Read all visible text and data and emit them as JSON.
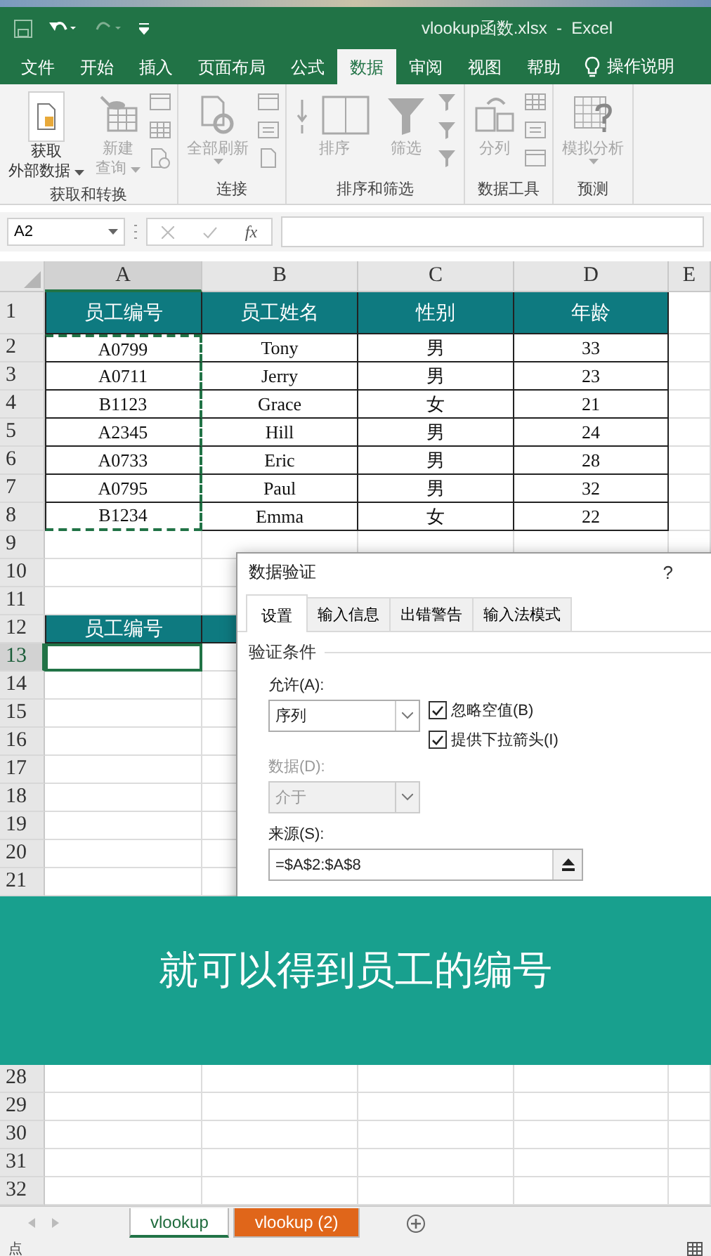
{
  "window": {
    "title": "vlookup函数.xlsx  -  Excel"
  },
  "ribbon_tabs": [
    {
      "label": "文件",
      "selected": false,
      "kind": "tab"
    },
    {
      "label": "开始",
      "selected": false,
      "kind": "tab"
    },
    {
      "label": "插入",
      "selected": false,
      "kind": "tab"
    },
    {
      "label": "页面布局",
      "selected": false,
      "kind": "tab"
    },
    {
      "label": "公式",
      "selected": false,
      "kind": "tab"
    },
    {
      "label": "数据",
      "selected": true,
      "kind": "tab"
    },
    {
      "label": "审阅",
      "selected": false,
      "kind": "tab"
    },
    {
      "label": "视图",
      "selected": false,
      "kind": "tab"
    },
    {
      "label": "帮助",
      "selected": false,
      "kind": "tab"
    },
    {
      "label": "操作说明",
      "selected": false,
      "kind": "tell_me"
    }
  ],
  "ribbon": {
    "groups": [
      {
        "label": "获取和转换",
        "buttons": [
          {
            "lines": [
              "获取",
              "外部数据"
            ],
            "kind": "get_data",
            "dropdown": true,
            "disabled": false
          },
          {
            "lines": [
              "新建",
              "查询"
            ],
            "kind": "new_query",
            "dropdown": true,
            "disabled": true
          }
        ],
        "small_tools": [
          {
            "kind": "table"
          },
          {
            "kind": "grid"
          },
          {
            "kind": "clock"
          }
        ]
      },
      {
        "label": "连接",
        "buttons": [
          {
            "lines": [
              "全部刷新"
            ],
            "kind": "refresh",
            "dropdown": true,
            "disabled": true
          }
        ],
        "small_tools": [
          {
            "kind": "table"
          },
          {
            "kind": "list"
          },
          {
            "kind": "doc"
          }
        ]
      },
      {
        "label": "排序和筛选",
        "buttons": [
          {
            "lines": [
              "排序"
            ],
            "kind": "sort",
            "dropdown": false,
            "disabled": true
          },
          {
            "lines": [
              "筛选"
            ],
            "kind": "filter",
            "dropdown": false,
            "disabled": true
          }
        ],
        "small_tools": [
          {
            "kind": "funnel"
          },
          {
            "kind": "funnel"
          },
          {
            "kind": "funnel"
          }
        ]
      },
      {
        "label": "数据工具",
        "buttons": [
          {
            "lines": [
              "分列"
            ],
            "kind": "split",
            "dropdown": false,
            "disabled": true
          }
        ],
        "small_tools": [
          {
            "kind": "grid"
          },
          {
            "kind": "list"
          },
          {
            "kind": "table"
          }
        ]
      },
      {
        "label": "预测",
        "buttons": [
          {
            "lines": [
              "模拟分析"
            ],
            "kind": "what_if",
            "dropdown": true,
            "disabled": true
          }
        ]
      }
    ]
  },
  "formula_bar": {
    "name_box": "A2",
    "function_label": "fx"
  },
  "columns": [
    {
      "label": "A",
      "selected": true
    },
    {
      "label": "B",
      "selected": false
    },
    {
      "label": "C",
      "selected": false
    },
    {
      "label": "D",
      "selected": false
    },
    {
      "label": "E",
      "selected": false
    }
  ],
  "rows": [
    {
      "label": "1",
      "selected": false,
      "cells": [
        {
          "kind": "table_header",
          "text": "员工编号"
        },
        {
          "kind": "table_header",
          "text": "员工姓名"
        },
        {
          "kind": "table_header",
          "text": "性别"
        },
        {
          "kind": "table_header",
          "text": "年龄"
        }
      ]
    },
    {
      "label": "2",
      "selected": false,
      "cells": [
        {
          "kind": "table_cell",
          "text": "A0799",
          "copied": true
        },
        {
          "kind": "table_cell",
          "text": "Tony"
        },
        {
          "kind": "table_cell",
          "text": "男"
        },
        {
          "kind": "table_cell",
          "text": "33"
        }
      ]
    },
    {
      "label": "3",
      "selected": false,
      "cells": [
        {
          "kind": "table_cell",
          "text": "A0711",
          "copied": true
        },
        {
          "kind": "table_cell",
          "text": "Jerry"
        },
        {
          "kind": "table_cell",
          "text": "男"
        },
        {
          "kind": "table_cell",
          "text": "23"
        }
      ]
    },
    {
      "label": "4",
      "selected": false,
      "cells": [
        {
          "kind": "table_cell",
          "text": "B1123",
          "copied": true
        },
        {
          "kind": "table_cell",
          "text": "Grace"
        },
        {
          "kind": "table_cell",
          "text": "女"
        },
        {
          "kind": "table_cell",
          "text": "21"
        }
      ]
    },
    {
      "label": "5",
      "selected": false,
      "cells": [
        {
          "kind": "table_cell",
          "text": "A2345",
          "copied": true
        },
        {
          "kind": "table_cell",
          "text": "Hill"
        },
        {
          "kind": "table_cell",
          "text": "男"
        },
        {
          "kind": "table_cell",
          "text": "24"
        }
      ]
    },
    {
      "label": "6",
      "selected": false,
      "cells": [
        {
          "kind": "table_cell",
          "text": "A0733",
          "copied": true
        },
        {
          "kind": "table_cell",
          "text": "Eric"
        },
        {
          "kind": "table_cell",
          "text": "男"
        },
        {
          "kind": "table_cell",
          "text": "28"
        }
      ]
    },
    {
      "label": "7",
      "selected": false,
      "cells": [
        {
          "kind": "table_cell",
          "text": "A0795",
          "copied": true
        },
        {
          "kind": "table_cell",
          "text": "Paul"
        },
        {
          "kind": "table_cell",
          "text": "男"
        },
        {
          "kind": "table_cell",
          "text": "32"
        }
      ]
    },
    {
      "label": "8",
      "selected": false,
      "cells": [
        {
          "kind": "table_cell",
          "text": "B1234",
          "copied": true
        },
        {
          "kind": "table_cell",
          "text": "Emma"
        },
        {
          "kind": "table_cell",
          "text": "女"
        },
        {
          "kind": "table_cell",
          "text": "22"
        }
      ]
    },
    {
      "label": "9",
      "selected": false
    },
    {
      "label": "10",
      "selected": false
    },
    {
      "label": "11",
      "selected": false
    },
    {
      "label": "12",
      "selected": false,
      "cells": [
        {
          "kind": "table_header",
          "text": "员工编号"
        },
        {
          "kind": "table_header"
        }
      ]
    },
    {
      "label": "13",
      "selected": true,
      "cells": [
        {
          "kind": "active_cell"
        }
      ]
    },
    {
      "label": "14",
      "selected": false
    },
    {
      "label": "15",
      "selected": false
    },
    {
      "label": "16",
      "selected": false
    },
    {
      "label": "17",
      "selected": false
    },
    {
      "label": "18",
      "selected": false
    },
    {
      "label": "19",
      "selected": false
    },
    {
      "label": "20",
      "selected": false
    },
    {
      "label": "21",
      "selected": false
    },
    {},
    {},
    {},
    {},
    {},
    {},
    {
      "label": "28",
      "selected": false
    },
    {
      "label": "29",
      "selected": false
    },
    {
      "label": "30",
      "selected": false
    },
    {
      "label": "31",
      "selected": false
    },
    {
      "label": "32",
      "selected": false
    }
  ],
  "dialog": {
    "title": "数据验证",
    "help": "?",
    "tabs": [
      {
        "label": "设置",
        "selected": true
      },
      {
        "label": "输入信息",
        "selected": false
      },
      {
        "label": "出错警告",
        "selected": false
      },
      {
        "label": "输入法模式",
        "selected": false
      }
    ],
    "section": "验证条件",
    "allow": {
      "label": "允许(A):",
      "value": "序列",
      "disabled": false
    },
    "data": {
      "label": "数据(D):",
      "value": "介于",
      "disabled": true
    },
    "checkboxes": [
      {
        "label": "忽略空值(B)",
        "checked": true
      },
      {
        "label": "提供下拉箭头(I)",
        "checked": true
      }
    ],
    "source": {
      "label": "来源(S):",
      "value": "=$A$2:$A$8"
    }
  },
  "caption": "就可以得到员工的编号",
  "sheet_tabs": [
    {
      "label": "vlookup",
      "selected": true
    },
    {
      "label": "vlookup (2)",
      "selected": false,
      "color": "#e0661a"
    }
  ],
  "status_bar": {
    "text": "点"
  }
}
